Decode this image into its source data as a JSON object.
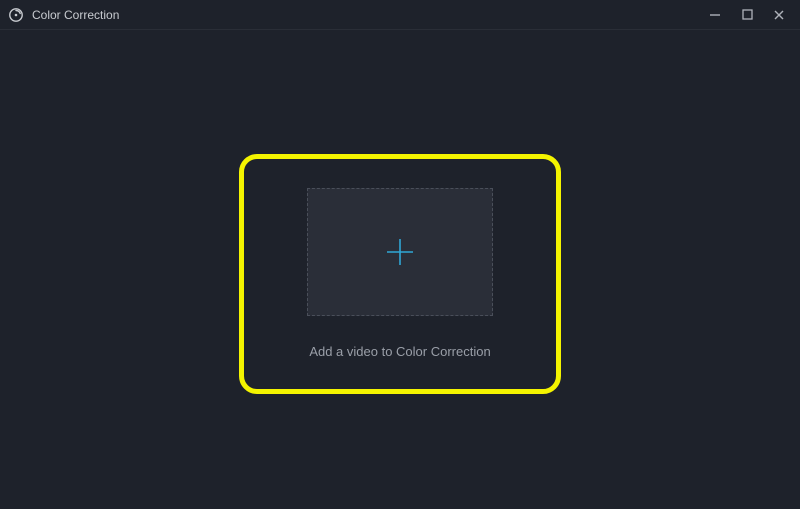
{
  "window": {
    "title": "Color Correction"
  },
  "main": {
    "drop_label": "Add a video to Color Correction"
  },
  "colors": {
    "accent": "#2fa7d6",
    "highlight": "#f4f400"
  }
}
